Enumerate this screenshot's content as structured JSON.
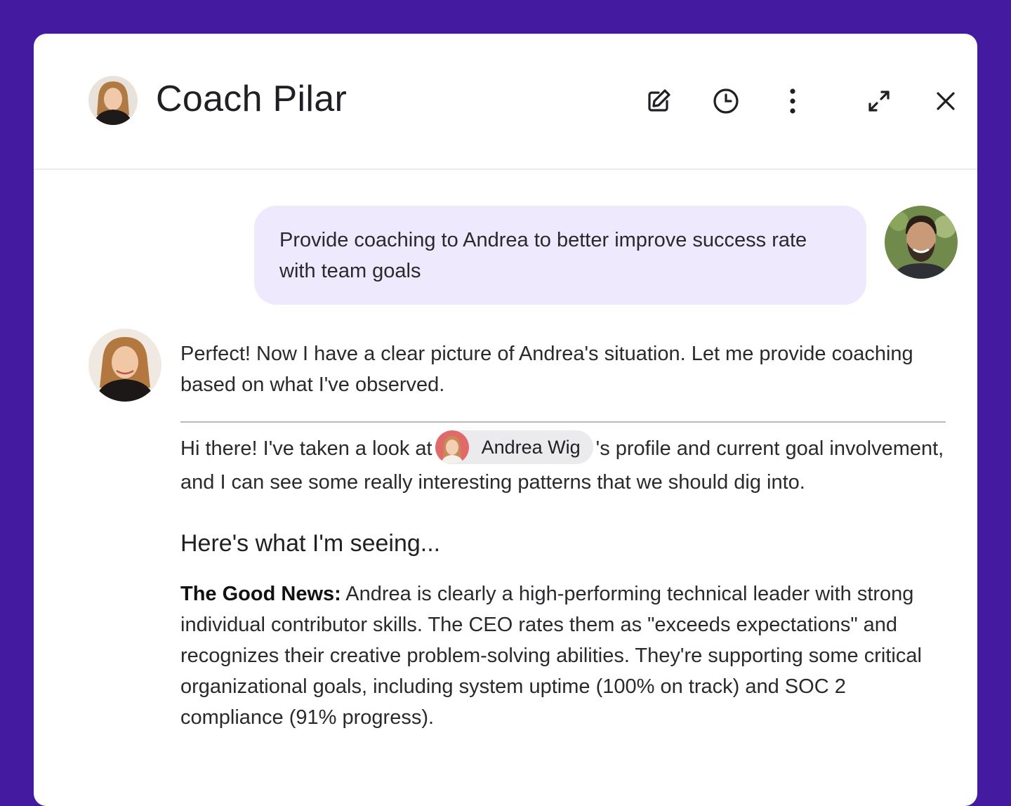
{
  "header": {
    "title": "Coach Pilar"
  },
  "toolbar": {
    "icons": [
      "edit-icon",
      "history-icon",
      "more-vertical-icon",
      "expand-icon",
      "close-icon"
    ]
  },
  "messages": {
    "user_prompt": "Provide coaching to Andrea to better improve success rate with team goals",
    "coach_intro": "Perfect! Now I have a clear picture of Andrea's situation. Let me provide coaching based on what I've observed.",
    "greeting_before": "Hi there! I've taken a look at",
    "mention_name": "Andrea Wig",
    "greeting_after": "'s profile and current goal involvement, and I can see some really interesting patterns that we should dig into.",
    "section_heading": "Here's what I'm seeing...",
    "good_news_label": "The Good News:",
    "good_news_text": " Andrea is clearly a high-performing technical leader with strong individual contributor skills. The CEO rates them as \"exceeds expectations\" and recognizes their creative problem-solving abilities. They're supporting some critical organizational goals, including system uptime (100% on track) and SOC 2 compliance (91% progress)."
  },
  "colors": {
    "background": "#431aa0",
    "panel": "#ffffff",
    "user_bubble": "#eee9fc",
    "mention_chip": "#ebebee"
  }
}
